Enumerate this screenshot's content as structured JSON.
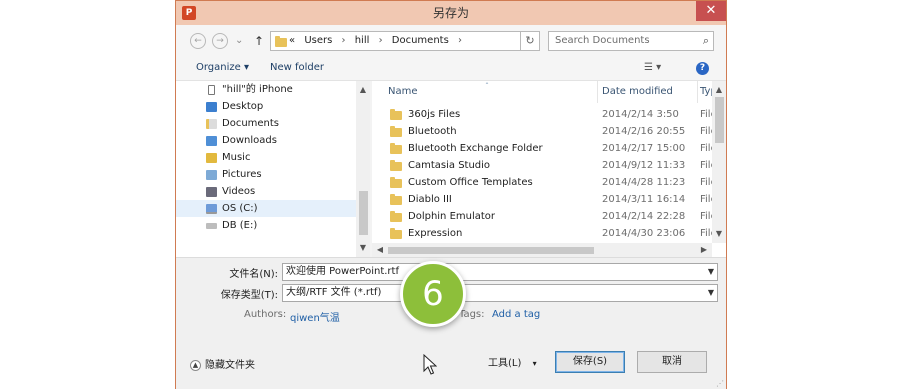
{
  "titlebar": {
    "app_icon": "P",
    "title": "另存为",
    "close_glyph": "✕"
  },
  "address": {
    "back_glyph": "←",
    "forward_glyph": "→",
    "recent_glyph": "⌄",
    "up_glyph": "↑",
    "crumb_overflow": "«",
    "crumbs": [
      "Users",
      "hill",
      "Documents"
    ],
    "crumb_sep": "›",
    "dropdown_glyph": "⌄",
    "refresh_glyph": "↻",
    "search_placeholder": "Search Documents",
    "search_glyph": "⌕"
  },
  "commands": {
    "organize": "Organize ▾",
    "new_folder": "New folder",
    "view_glyph": "☰ ▾",
    "help_glyph": "?"
  },
  "nav_items": [
    {
      "label": "\"hill\"的 iPhone"
    },
    {
      "label": "Desktop"
    },
    {
      "label": "Documents"
    },
    {
      "label": "Downloads"
    },
    {
      "label": "Music"
    },
    {
      "label": "Pictures"
    },
    {
      "label": "Videos"
    },
    {
      "label": "OS (C:)"
    },
    {
      "label": "DB (E:)"
    }
  ],
  "file_columns": {
    "name": "Name",
    "date": "Date modified",
    "type": "Typ"
  },
  "files": [
    {
      "name": "360js Files",
      "date": "2014/2/14 3:50",
      "type": "File"
    },
    {
      "name": "Bluetooth",
      "date": "2014/2/16 20:55",
      "type": "File"
    },
    {
      "name": "Bluetooth Exchange Folder",
      "date": "2014/2/17 15:00",
      "type": "File"
    },
    {
      "name": "Camtasia Studio",
      "date": "2014/9/12 11:33",
      "type": "File"
    },
    {
      "name": "Custom Office Templates",
      "date": "2014/4/28 11:23",
      "type": "File"
    },
    {
      "name": "Diablo III",
      "date": "2014/3/11 16:14",
      "type": "File"
    },
    {
      "name": "Dolphin Emulator",
      "date": "2014/2/14 22:28",
      "type": "File"
    },
    {
      "name": "Expression",
      "date": "2014/4/30 23:06",
      "type": "File"
    }
  ],
  "form": {
    "filename_label": "文件名(N):",
    "filename_value": "欢迎使用 PowerPoint.rtf",
    "filetype_label": "保存类型(T):",
    "filetype_value": "大纲/RTF 文件 (*.rtf)",
    "authors_label": "Authors:",
    "authors_value": "qiwen气温",
    "tags_label": "Tags:",
    "tags_value": "Add a tag"
  },
  "footer": {
    "hide_folders": "隐藏文件夹",
    "tools": "工具(L)",
    "tools_caret": "▾",
    "save": "保存(S)",
    "cancel": "取消"
  },
  "step_badge": "6",
  "colors": {
    "badge": "#8dbf3a",
    "titlebar": "#f1c8b2",
    "close": "#c75050",
    "link": "#1f5fa6"
  }
}
